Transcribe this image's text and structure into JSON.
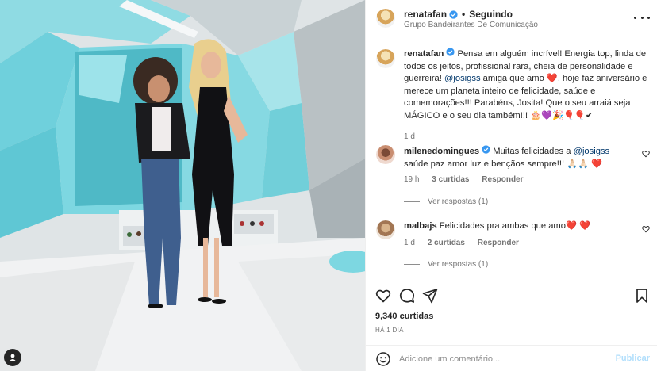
{
  "post": {
    "username": "renatafan",
    "dot": "•",
    "follow_status": "Seguindo",
    "subtitle": "Grupo Bandeirantes De Comunicação"
  },
  "caption": {
    "username": "renatafan",
    "text_1": " Pensa em alguém incrível! Energia top, linda de todos os jeitos, profissional rara, cheia de personalidade e guerreira! ",
    "mention": "@josigss",
    "text_2": " amiga que amo ",
    "heart": "❤️",
    "text_3": ", hoje faz aniversário e merece um planeta inteiro de felicidade, saúde e comemorações!!! Parabéns, Josita! Que o seu arraiá seja MÁGICO e o seu dia também!!! 🎂💜🎉🎈🎈✔",
    "time": "1 d"
  },
  "comments": [
    {
      "username": "milenedomingues",
      "text_1": " Muitas felicidades a ",
      "mention": "@josigss",
      "text_2": " saúde paz amor luz e bençãos sempre!!! 🙏🏻🙏🏻 ❤️",
      "time": "19 h",
      "likes": "3 curtidas",
      "reply_label": "Responder",
      "view_replies": "Ver respostas (1)"
    },
    {
      "username": "malbajs",
      "text_1": " Felicidades pra ambas que amo❤️ ❤️",
      "time": "1 d",
      "likes": "2 curtidas",
      "reply_label": "Responder",
      "view_replies": "Ver respostas (1)"
    }
  ],
  "stats": {
    "likes": "9,340 curtidas",
    "posted_ago": "HÁ 1 DIA"
  },
  "composer": {
    "placeholder": "Adicione um comentário...",
    "post_label": "Publicar"
  },
  "colors": {
    "link": "#00376b",
    "like_red": "#ed4956",
    "post_disabled": "#b2dffc",
    "studio_teal": "#6fd0dc"
  },
  "icons": {
    "header_more": "more-horizontal-icon",
    "verified": "verified-badge-icon",
    "like": "heart-outline-icon",
    "comment": "comment-bubble-icon",
    "share": "paper-plane-icon",
    "save": "bookmark-icon",
    "emoji": "emoji-smile-icon",
    "user_tag": "person-tag-icon"
  }
}
